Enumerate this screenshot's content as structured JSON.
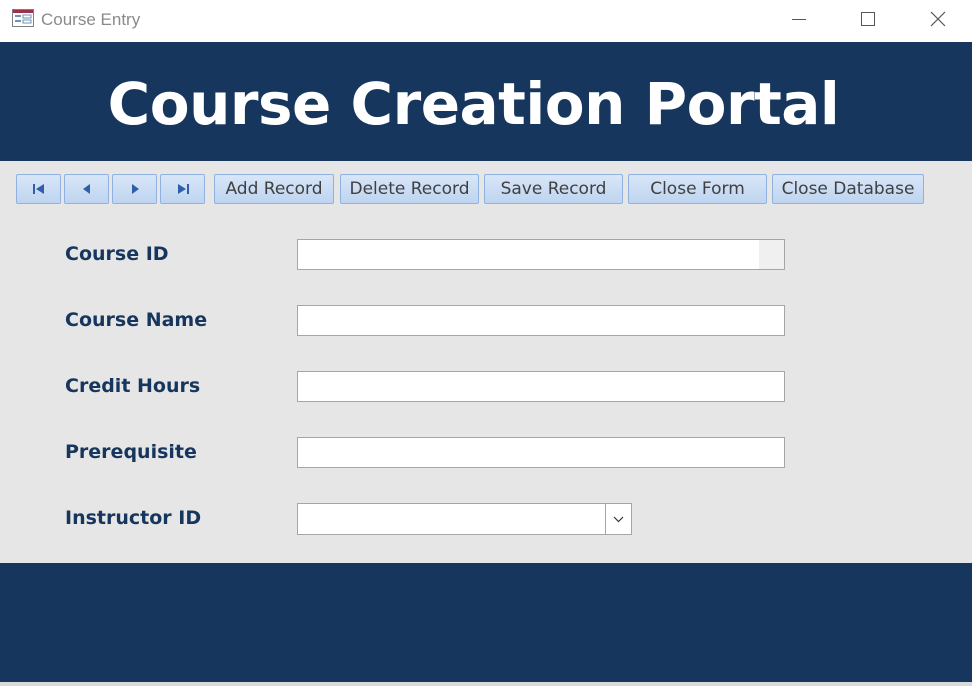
{
  "window": {
    "title": "Course Entry",
    "icon": "form-icon",
    "controls": [
      "minimize-icon",
      "maximize-icon",
      "close-icon"
    ]
  },
  "header": {
    "title": "Course Creation Portal",
    "background_color": "#17365d",
    "title_color": "#ffffff"
  },
  "toolbar": {
    "navigation": [
      "first-record-icon",
      "previous-record-icon",
      "next-record-icon",
      "last-record-icon"
    ],
    "add_label": "Add Record",
    "delete_label": "Delete Record",
    "save_label": "Save Record",
    "close_form_label": "Close Form",
    "close_database_label": "Close Database",
    "button_color": "#c9dbf3"
  },
  "form": {
    "label_color": "#17365d",
    "background_color": "#e6e6e6",
    "fields": {
      "course_id": {
        "label": "Course ID",
        "value": ""
      },
      "course_name": {
        "label": "Course Name",
        "value": ""
      },
      "credit_hours": {
        "label": "Credit Hours",
        "value": ""
      },
      "prerequisite": {
        "label": "Prerequisite",
        "value": ""
      },
      "instructor_id": {
        "label": "Instructor ID",
        "value": "",
        "icon": "chevron-down-icon"
      }
    }
  },
  "footer": {
    "background_color": "#17365d"
  }
}
